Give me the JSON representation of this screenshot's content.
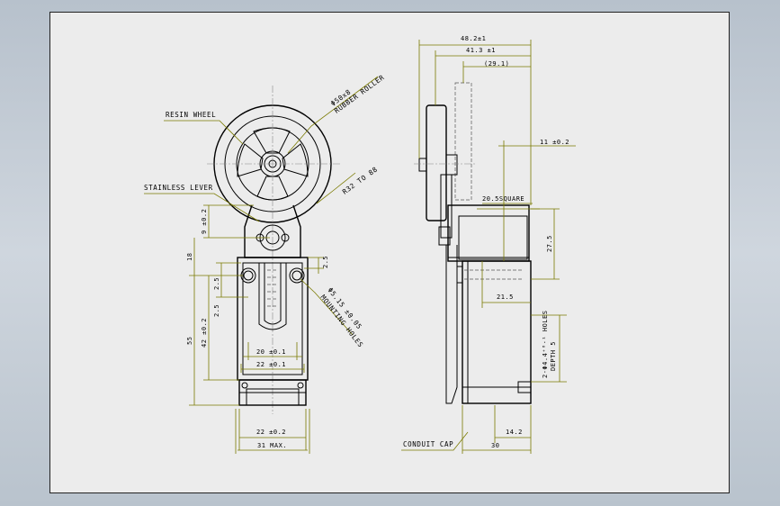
{
  "labels": {
    "resin_wheel": "RESIN WHEEL",
    "rubber_roller_dia": "Φ50x8",
    "rubber_roller": "RUBBER ROLLER",
    "stainless_lever": "STAINLESS LEVER",
    "r_to": "R32 TO 88",
    "mounting_holes_dia": "Φ5.15 ±0.05",
    "mounting_holes": "MOUNTING HOLES",
    "conduit_cap": "CONDUIT CAP",
    "holes_spec": "2-Φ4.4⁺⁰·¹ HOLES",
    "depth": "DEPTH 5",
    "square": "20.5SQUARE"
  },
  "dims": {
    "d_48": "48.2±1",
    "d_41": "41.3 ±1",
    "d_29": "(29.1)",
    "d_11": "11 ±0.2",
    "d_27": "27.5",
    "d_21": "21.5",
    "d_14": "14.2",
    "d_30": "30",
    "d_9": "9 ±0.2",
    "d_18": "18",
    "d_25a": "2.5",
    "d_25b": "2.5",
    "d_25c": "2.5",
    "d_55": "55",
    "d_42": "42 ±0.2",
    "d_20": "20 ±0.1",
    "d_22a": "22 ±0.1",
    "d_22b": "22 ±0.2",
    "d_31": "31 MAX."
  }
}
